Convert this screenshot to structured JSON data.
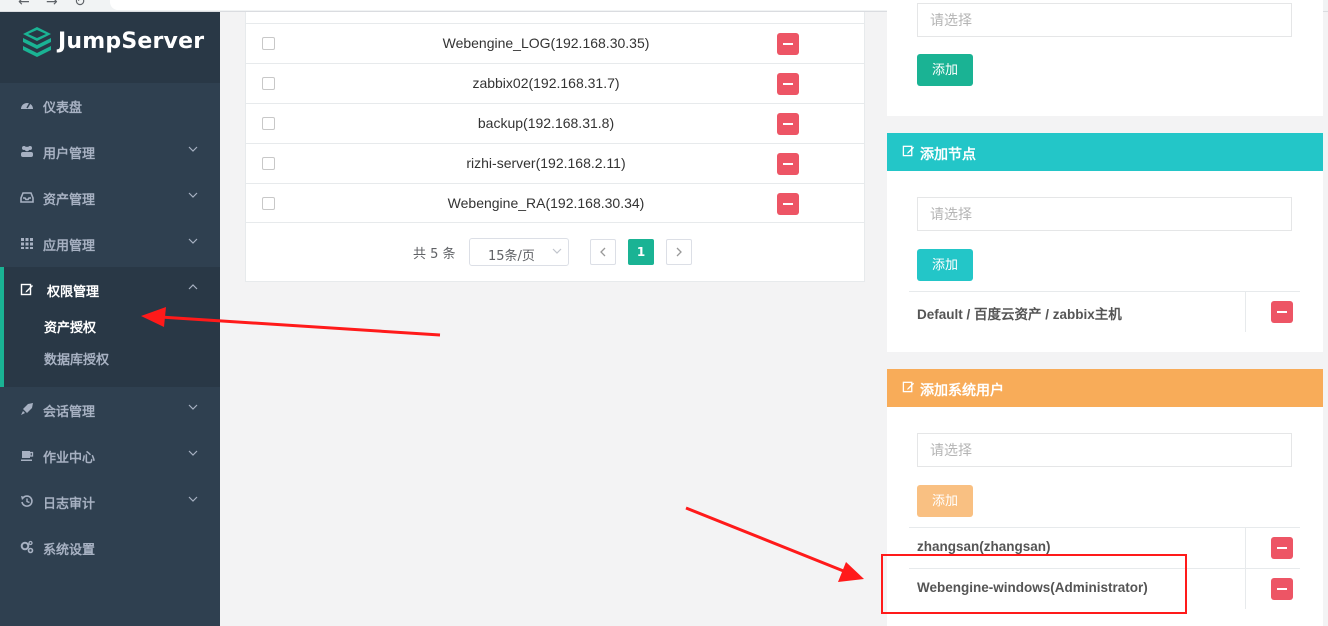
{
  "brand": {
    "name": "JumpServer"
  },
  "sidebar": {
    "items": [
      {
        "label": "仪表盘",
        "icon": "dashboard-icon"
      },
      {
        "label": "用户管理",
        "icon": "users-icon"
      },
      {
        "label": "资产管理",
        "icon": "inbox-icon"
      },
      {
        "label": "应用管理",
        "icon": "grid-icon"
      },
      {
        "label": "权限管理",
        "icon": "edit-icon",
        "active": true,
        "children": [
          {
            "label": "资产授权",
            "active": true
          },
          {
            "label": "数据库授权"
          }
        ]
      },
      {
        "label": "会话管理",
        "icon": "rocket-icon"
      },
      {
        "label": "作业中心",
        "icon": "coffee-icon"
      },
      {
        "label": "日志审计",
        "icon": "history-icon"
      },
      {
        "label": "系统设置",
        "icon": "cogs-icon"
      }
    ]
  },
  "assets": {
    "rows": [
      {
        "name": "Webengine_LOG(192.168.30.35)"
      },
      {
        "name": "zabbix02(192.168.31.7)"
      },
      {
        "name": "backup(192.168.31.8)"
      },
      {
        "name": "rizhi-server(192.168.2.11)"
      },
      {
        "name": "Webengine_RA(192.168.30.34)"
      }
    ],
    "pagination": {
      "total": "共 5 条",
      "page_size": "15条/页",
      "current_page": "1"
    }
  },
  "panels": {
    "top": {
      "placeholder": "请选择",
      "add_label": "添加"
    },
    "add_node": {
      "title": "添加节点",
      "placeholder": "请选择",
      "add_label": "添加",
      "items": [
        "Default / 百度云资产 / zabbix主机"
      ]
    },
    "add_system_user": {
      "title": "添加系统用户",
      "placeholder": "请选择",
      "add_label": "添加",
      "items": [
        "zhangsan(zhangsan)",
        "Webengine-windows(Administrator)"
      ]
    }
  },
  "colors": {
    "sidebar_bg": "#2f4050",
    "primary": "#1ab394",
    "info": "#23c6c8",
    "warning": "#f8ac59",
    "danger": "#ed5565",
    "annotation": "#ff1a1a"
  }
}
